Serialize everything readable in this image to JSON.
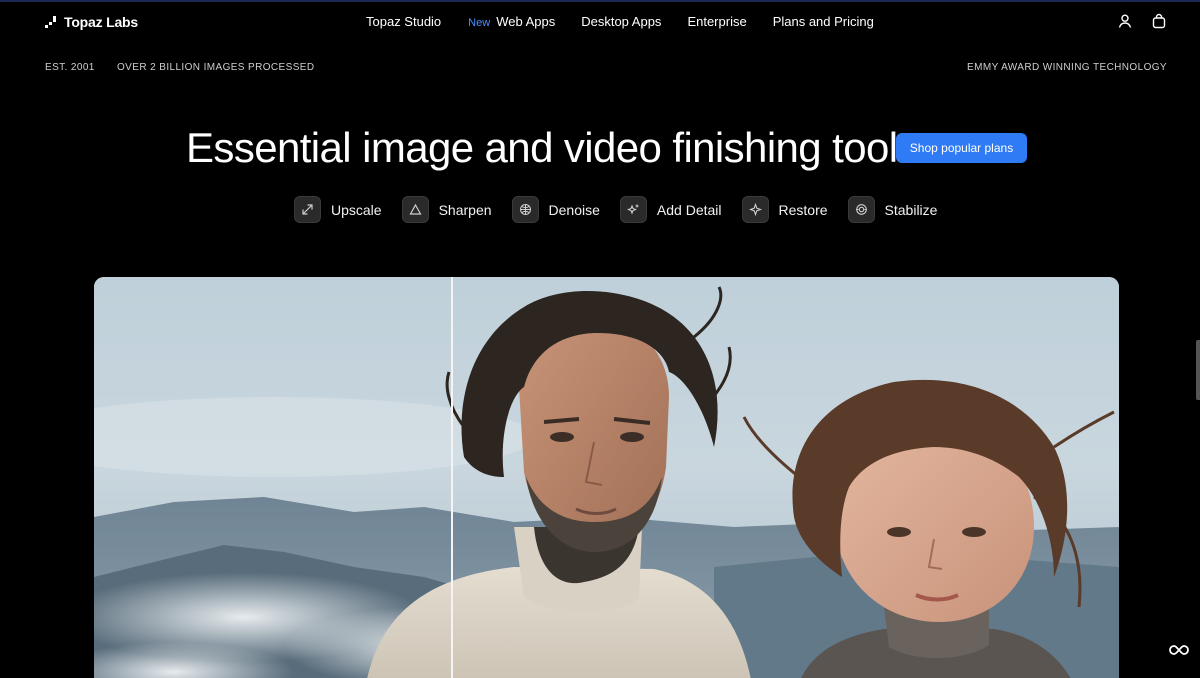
{
  "nav": {
    "logo": "Topaz Labs",
    "links": [
      {
        "label": "Topaz Studio"
      },
      {
        "label": "Web Apps",
        "badge": "New"
      },
      {
        "label": "Desktop Apps"
      },
      {
        "label": "Enterprise"
      },
      {
        "label": "Plans and Pricing"
      }
    ],
    "icons": [
      "account-icon",
      "cart-icon"
    ]
  },
  "stats": {
    "established": "EST. 2001",
    "images": "OVER 2 BILLION IMAGES PROCESSED",
    "award": "EMMY AWARD WINNING TECHNOLOGY"
  },
  "hero": {
    "headline": "Essential image and video finishing tools.",
    "cta": "Shop popular plans"
  },
  "tools": [
    {
      "label": "Upscale",
      "icon": "upscale-icon"
    },
    {
      "label": "Sharpen",
      "icon": "sharpen-icon"
    },
    {
      "label": "Denoise",
      "icon": "denoise-icon"
    },
    {
      "label": "Add Detail",
      "icon": "add-detail-icon"
    },
    {
      "label": "Restore",
      "icon": "restore-icon"
    },
    {
      "label": "Stabilize",
      "icon": "stabilize-icon"
    }
  ],
  "colors": {
    "background": "#000000",
    "accent": "#2f7bf5",
    "new_badge": "#4f8dff"
  }
}
